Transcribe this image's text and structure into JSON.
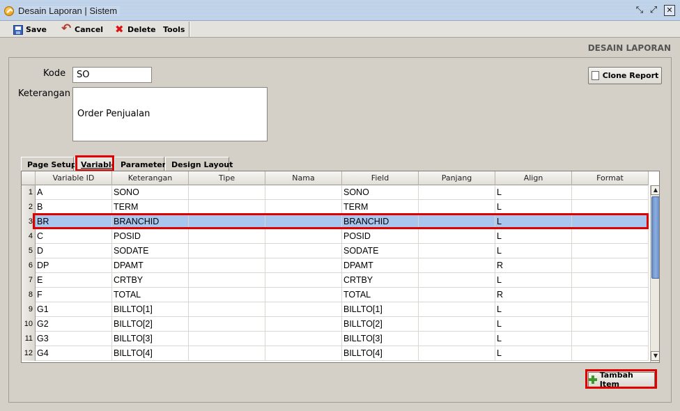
{
  "window": {
    "title": "Desain Laporan | Sistem",
    "controls": {
      "restore": "⤡",
      "maximize": "⤢",
      "close": "✕"
    }
  },
  "toolbar": {
    "save_label": "Save",
    "cancel_label": "Cancel",
    "delete_label": "Delete",
    "tools_label": "Tools"
  },
  "section_title": "DESAIN LAPORAN",
  "form": {
    "kode_label": "Kode",
    "kode_value": "SO",
    "keterangan_label": "Keterangan",
    "keterangan_value": "Order Penjualan",
    "clone_report_label": "Clone Report"
  },
  "tabs": [
    {
      "label": "Page Setup",
      "active": false
    },
    {
      "label": "Variable",
      "active": true
    },
    {
      "label": "Parameter",
      "active": false
    },
    {
      "label": "Design Layout",
      "active": false
    }
  ],
  "grid": {
    "columns": [
      "Variable ID",
      "Keterangan",
      "Tipe",
      "Nama",
      "Field",
      "Panjang",
      "Align",
      "Format"
    ],
    "selected_row": 3,
    "rows": [
      {
        "n": "1",
        "id": "A",
        "ket": "SONO",
        "tipe": "",
        "nama": "",
        "field": "SONO",
        "panjang": "",
        "align": "L",
        "format": ""
      },
      {
        "n": "2",
        "id": "B",
        "ket": "TERM",
        "tipe": "",
        "nama": "",
        "field": "TERM",
        "panjang": "",
        "align": "L",
        "format": ""
      },
      {
        "n": "3",
        "id": "BR",
        "ket": "BRANCHID",
        "tipe": "",
        "nama": "",
        "field": "BRANCHID",
        "panjang": "",
        "align": "L",
        "format": ""
      },
      {
        "n": "4",
        "id": "C",
        "ket": "POSID",
        "tipe": "",
        "nama": "",
        "field": "POSID",
        "panjang": "",
        "align": "L",
        "format": ""
      },
      {
        "n": "5",
        "id": "D",
        "ket": "SODATE",
        "tipe": "",
        "nama": "",
        "field": "SODATE",
        "panjang": "",
        "align": "L",
        "format": ""
      },
      {
        "n": "6",
        "id": "DP",
        "ket": "DPAMT",
        "tipe": "",
        "nama": "",
        "field": "DPAMT",
        "panjang": "",
        "align": "R",
        "format": ""
      },
      {
        "n": "7",
        "id": "E",
        "ket": "CRTBY",
        "tipe": "",
        "nama": "",
        "field": "CRTBY",
        "panjang": "",
        "align": "L",
        "format": ""
      },
      {
        "n": "8",
        "id": "F",
        "ket": "TOTAL",
        "tipe": "",
        "nama": "",
        "field": "TOTAL",
        "panjang": "",
        "align": "R",
        "format": ""
      },
      {
        "n": "9",
        "id": "G1",
        "ket": "BILLTO[1]",
        "tipe": "",
        "nama": "",
        "field": "BILLTO[1]",
        "panjang": "",
        "align": "L",
        "format": ""
      },
      {
        "n": "10",
        "id": "G2",
        "ket": "BILLTO[2]",
        "tipe": "",
        "nama": "",
        "field": "BILLTO[2]",
        "panjang": "",
        "align": "L",
        "format": ""
      },
      {
        "n": "11",
        "id": "G3",
        "ket": "BILLTO[3]",
        "tipe": "",
        "nama": "",
        "field": "BILLTO[3]",
        "panjang": "",
        "align": "L",
        "format": ""
      },
      {
        "n": "12",
        "id": "G4",
        "ket": "BILLTO[4]",
        "tipe": "",
        "nama": "",
        "field": "BILLTO[4]",
        "panjang": "",
        "align": "L",
        "format": ""
      }
    ]
  },
  "scrollbar": {
    "up": "▲",
    "down": "▼"
  },
  "tambah_item_label": "Tambah Item",
  "colors": {
    "selected_row": "#a9c6ef",
    "highlight": "#e00000",
    "titlebar": "#c8d8ec"
  }
}
